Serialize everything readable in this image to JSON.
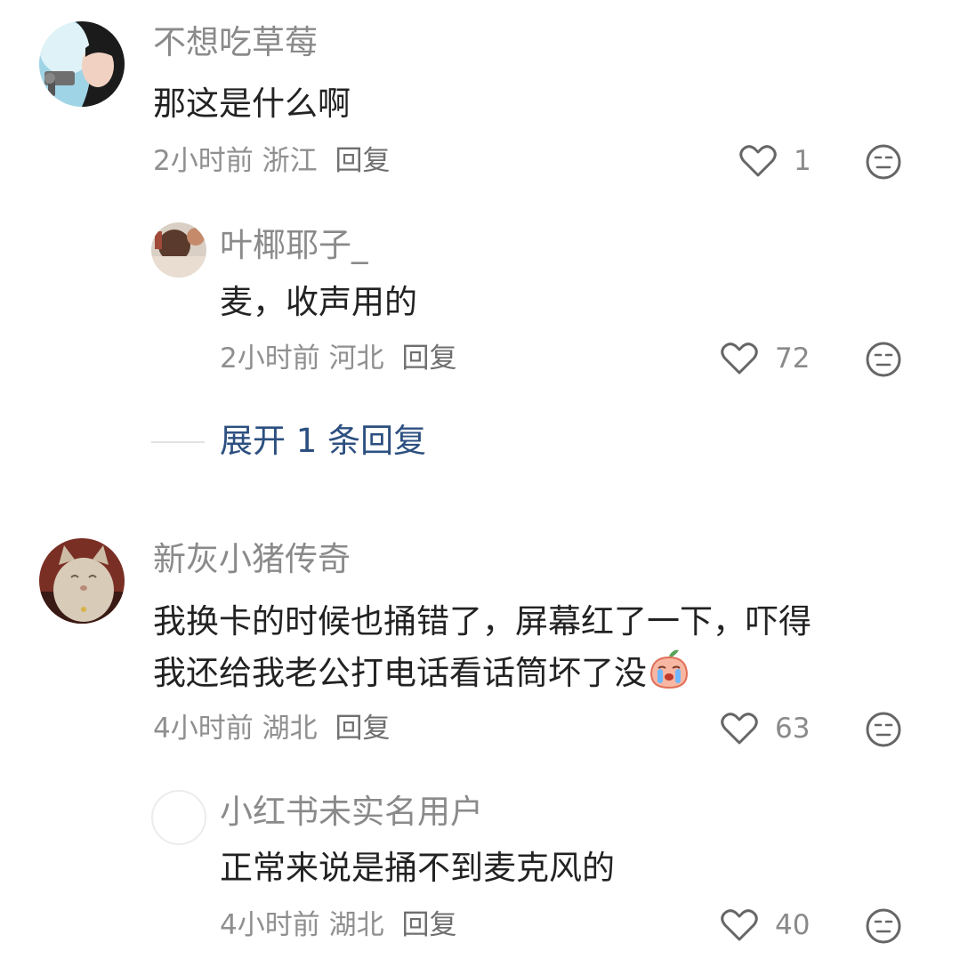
{
  "comments": [
    {
      "username": "不想吃草莓",
      "content": "那这是什么啊",
      "time": "2小时前",
      "location": "浙江",
      "reply_label": "回复",
      "likes": "1",
      "replies": [
        {
          "username": "叶椰耶子_",
          "content": "麦，收声用的",
          "time": "2小时前",
          "location": "河北",
          "reply_label": "回复",
          "likes": "72"
        }
      ],
      "expand_label": "展开 1 条回复"
    },
    {
      "username": "新灰小猪传奇",
      "content_line1": "我换卡的时候也捅错了，屏幕红了一下，吓得",
      "content_line2": "我还给我老公打电话看话筒坏了没",
      "time": "4小时前",
      "location": "湖北",
      "reply_label": "回复",
      "likes": "63",
      "replies": [
        {
          "username": "小红书未实名用户",
          "content": "正常来说是捅不到麦克风的",
          "time": "4小时前",
          "location": "湖北",
          "reply_label": "回复",
          "likes": "40"
        }
      ]
    }
  ],
  "icons": {
    "like": "heart-outline-icon",
    "emoji": "neutral-face-icon",
    "inline_emoji": "crying-peach-emoji"
  },
  "colors": {
    "username": "#8a8a8a",
    "text": "#222222",
    "meta": "#8f8f8f",
    "link": "#2c4f80",
    "icon": "#666666"
  }
}
